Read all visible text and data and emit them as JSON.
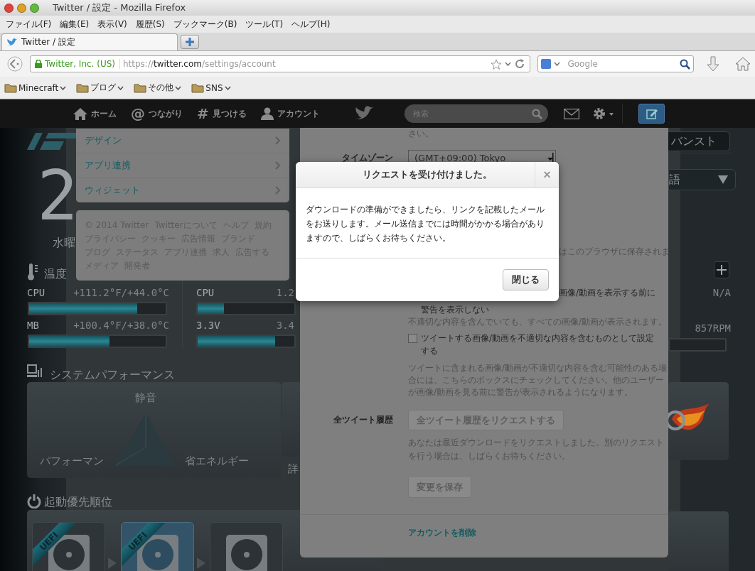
{
  "window": {
    "title": "Twitter / 設定 - Mozilla Firefox"
  },
  "menu_bar": [
    "ファイル(F)",
    "編集(E)",
    "表示(V)",
    "履歴(S)",
    "ブックマーク(B)",
    "ツール(T)",
    "ヘルプ(H)"
  ],
  "tabs": [
    {
      "label": "Twitter / 設定",
      "selected": true
    }
  ],
  "address_bar": {
    "identity": "Twitter, Inc. (US)",
    "url": "https://**twitter.com**/settings/account"
  },
  "search_bar": {
    "placeholder": "Google"
  },
  "bookmarks": [
    "Minecraft",
    "ブログ",
    "その他",
    "SNS"
  ],
  "twitter_nav": {
    "items": [
      {
        "kind": "home",
        "label": "ホーム"
      },
      {
        "kind": "glyph",
        "glyph": "@",
        "label": "つながり"
      },
      {
        "kind": "glyph",
        "glyph": "#",
        "label": "見つける"
      },
      {
        "kind": "person",
        "label": "アカウント"
      }
    ],
    "search": {
      "placeholder": "検索"
    }
  },
  "background_app": {
    "clock_digit": "2",
    "weekday": "水曜",
    "temperature": {
      "title": "温度",
      "rows": [
        {
          "name": "CPU",
          "reading": "+111.2°F/+44.0°C",
          "level": 0.79
        },
        {
          "name": "MB",
          "reading": "+100.4°F/+38.0°C",
          "level": 0.59
        }
      ]
    },
    "voltage": {
      "rows": [
        {
          "name": "CPU",
          "reading": "1.2",
          "level": 0.27
        },
        {
          "name": "3.3V",
          "reading": "3.4",
          "level": 0.8
        }
      ]
    },
    "performance": {
      "title": "システムパフォーマンス",
      "top": "静音",
      "left": "パフォーマン",
      "right": "省エネルギー",
      "next_label": "詳"
    },
    "boot": {
      "title": "起動優先順位",
      "devices": [
        {
          "badge": "UEFI",
          "selected": false
        },
        {
          "badge": "UEFI",
          "selected": true
        },
        {
          "selected": false
        }
      ]
    },
    "right": {
      "button": "バンスト",
      "dropdown": "語",
      "fan_status": "N/A",
      "fan_speed": "857RPM"
    }
  },
  "settings_menu": [
    "デザイン",
    "アプリ連携",
    "ウィジェット"
  ],
  "footer_links": [
    "© 2014 Twitter",
    "Twitterについて",
    "ヘルプ",
    "規約",
    "プライバシー",
    "クッキー",
    "広告情報",
    "ブランド",
    "ブログ",
    "ステータス",
    "アプリ連携",
    "求人",
    "広告する",
    "メディア",
    "開発者"
  ],
  "settings": {
    "intro_tail": "さい。",
    "timezone": {
      "label": "タイムゾーン",
      "value": "(GMT+09:00) Tokyo"
    },
    "saved_note_tail": "はこのブラウザに保存されま",
    "media_option": {
      "label_tail": "画像/動画を表示する前に",
      "label_line2": "警告を表示しない",
      "help": "不適切な内容を含んでいても、すべての画像/動画が表示されます。"
    },
    "sensitive_option": {
      "label": "ツイートする画像/動画を不適切な内容を含むものとして設定する",
      "checked": false,
      "help": "ツイートに含まれる画像/動画が不適切な内容を含む可能性のある場合には、こちらのボックスにチェックしてください。他のユーザーが画像/動画を見る前に警告が表示されるようになります。"
    },
    "archive": {
      "label": "全ツイート履歴",
      "button": "全ツイート履歴をリクエストする",
      "note": "あなたは最近ダウンロードをリクエストしました。別のリクエストを行う場合は、しばらくお待ちください。"
    },
    "save_button": "変更を保存",
    "delete_link": "アカウントを削除"
  },
  "dialog": {
    "title": "リクエストを受け付けました。",
    "close": "×",
    "message": "ダウンロードの準備ができましたら、リンクを記載したメールをお送りします。メール送信までには時間がかかる場合がありますので、しばらくお待ちください。",
    "button": "閉じる"
  }
}
